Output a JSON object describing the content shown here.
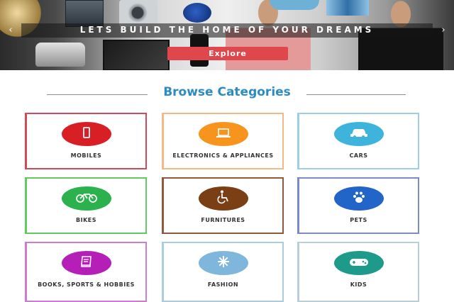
{
  "hero": {
    "title": "LETS BUILD THE HOME OF YOUR DREAMS",
    "button_label": "Explore",
    "prev_arrow": "‹",
    "next_arrow": "›"
  },
  "section": {
    "title": "Browse Categories"
  },
  "categories": [
    {
      "label": "MOBILES",
      "icon": "mobile-icon",
      "color": "#d91f26",
      "border": "#d24a57"
    },
    {
      "label": "ELECTRONICS & APPLIANCES",
      "icon": "laptop-icon",
      "color": "#f7941d",
      "border": "#f4b884"
    },
    {
      "label": "CARS",
      "icon": "car-icon",
      "color": "#3eb4dc",
      "border": "#9ccfe3"
    },
    {
      "label": "BIKES",
      "icon": "bike-icon",
      "color": "#2bb24c",
      "border": "#5fcb62"
    },
    {
      "label": "FURNITURES",
      "icon": "wheelchair-icon",
      "color": "#7b3f16",
      "border": "#8f5a3a"
    },
    {
      "label": "PETS",
      "icon": "paw-icon",
      "color": "#2265c9",
      "border": "#7a8cc8"
    },
    {
      "label": "BOOKS, SPORTS & HOBBIES",
      "icon": "book-icon",
      "color": "#b51fb8",
      "border": "#cc7dd1"
    },
    {
      "label": "FASHION",
      "icon": "snowflake-icon",
      "color": "#7fb6db",
      "border": "#a9cde0"
    },
    {
      "label": "KIDS",
      "icon": "gamepad-icon",
      "color": "#1e9a8a",
      "border": "#b6cfd8"
    }
  ]
}
